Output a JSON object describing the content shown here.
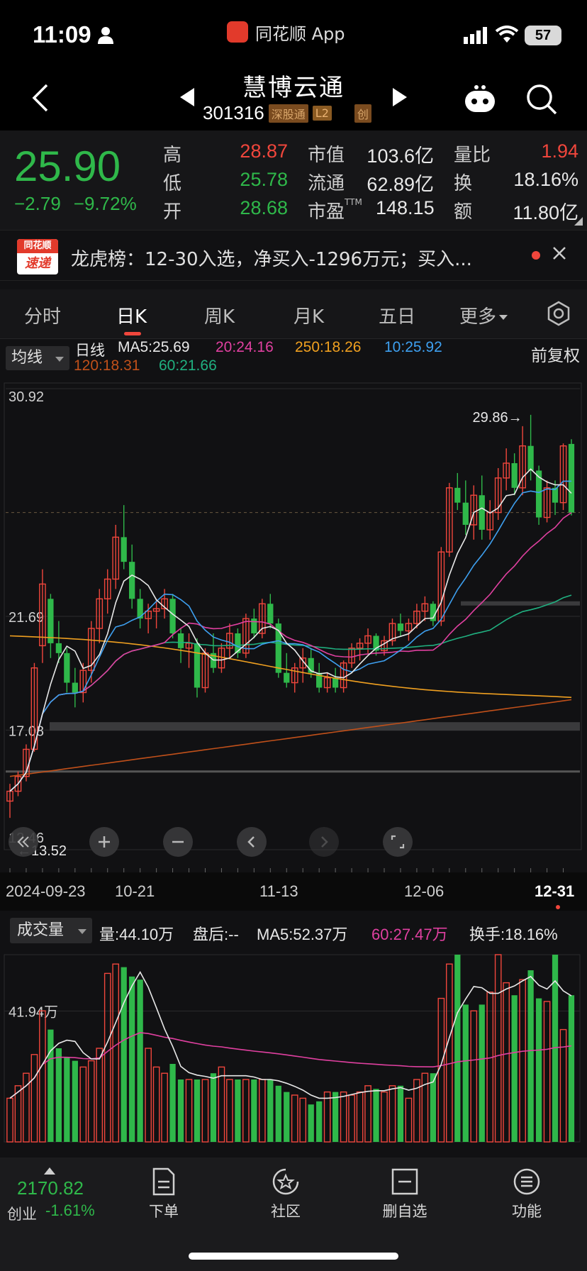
{
  "status_bar": {
    "time": "11:09",
    "app_label": "同花顺 App",
    "battery": "57"
  },
  "nav": {
    "stock_name": "慧博云通",
    "stock_code": "301316",
    "badges": [
      "深股通",
      "L2",
      "创"
    ]
  },
  "quote": {
    "price": "25.90",
    "change": "−2.79",
    "change_pct": "−9.72%",
    "high_label": "高",
    "high": "28.87",
    "low_label": "低",
    "low": "25.78",
    "open_label": "开",
    "open": "28.68",
    "mcap_label": "市值",
    "mcap": "103.6亿",
    "float_label": "流通",
    "float": "62.89亿",
    "pe_label": "市盈",
    "pe_sup": "TTM",
    "pe": "148.15",
    "vr_label": "量比",
    "vr": "1.94",
    "turnover_label": "换",
    "turnover": "18.16%",
    "amount_label": "额",
    "amount": "11.80亿"
  },
  "news": {
    "logo_top": "同花顺",
    "logo_bottom": "速递",
    "text": "龙虎榜：12-30入选，净买入-1296万元；买入..."
  },
  "tabs": [
    "分时",
    "日K",
    "周K",
    "月K",
    "五日",
    "更多"
  ],
  "ma_legend": {
    "select": "均线",
    "line_label": "日线",
    "right_label": "前复权",
    "items": [
      {
        "text": "MA5:25.69",
        "color": "#e8e8e8"
      },
      {
        "text": "20:24.16",
        "color": "#e040a0"
      },
      {
        "text": "250:18.26",
        "color": "#f0a020"
      },
      {
        "text": "10:25.92",
        "color": "#3ea0f0"
      },
      {
        "text": "120:18.31",
        "color": "#c0501a"
      },
      {
        "text": "60:21.66",
        "color": "#20b080"
      }
    ]
  },
  "price_axis": {
    "top": "30.92",
    "mid": "21.69",
    "low": "17.08",
    "bottom": "12.46",
    "max_mark": "29.86→",
    "min_mark": "←13.52"
  },
  "dates": [
    "2024-09-23",
    "10-21",
    "11-13",
    "12-06",
    "12-31"
  ],
  "vol_legend": {
    "select": "成交量",
    "vol": "量:44.10万",
    "after": "盘后:--",
    "ma5": "MA5:52.37万",
    "ma60": "60:27.47万",
    "turnover": "换手:18.16%",
    "axis_label": "41.94万"
  },
  "bottom_bar": {
    "index_value": "2170.82",
    "index_name": "创业",
    "index_change": "-1.61%",
    "buttons": [
      "下单",
      "社区",
      "删自选",
      "功能"
    ]
  },
  "chart_data": {
    "type": "candlestick",
    "x_range": [
      "2024-09-23",
      "2024-12-31"
    ],
    "y_range": [
      12.46,
      30.92
    ],
    "candles": [
      [
        14.2,
        14.9,
        13.52,
        14.6
      ],
      [
        14.6,
        15.4,
        14.4,
        15.2
      ],
      [
        15.2,
        16.5,
        15.0,
        16.3
      ],
      [
        16.3,
        19.8,
        16.2,
        19.6
      ],
      [
        20.5,
        23.6,
        19.8,
        23.0
      ],
      [
        22.4,
        22.6,
        20.0,
        20.6
      ],
      [
        20.6,
        21.5,
        19.8,
        20.2
      ],
      [
        20.2,
        20.4,
        18.6,
        19.0
      ],
      [
        19.0,
        19.6,
        18.0,
        18.6
      ],
      [
        18.6,
        19.8,
        18.2,
        19.5
      ],
      [
        19.5,
        21.5,
        19.0,
        21.2
      ],
      [
        21.2,
        22.8,
        20.6,
        22.4
      ],
      [
        22.4,
        23.6,
        21.8,
        23.2
      ],
      [
        23.2,
        25.4,
        22.8,
        24.9
      ],
      [
        24.9,
        26.2,
        23.6,
        23.9
      ],
      [
        23.9,
        24.6,
        22.0,
        22.4
      ],
      [
        22.4,
        22.8,
        21.2,
        21.6
      ],
      [
        21.6,
        22.2,
        21.0,
        21.9
      ],
      [
        21.9,
        22.4,
        21.2,
        22.0
      ],
      [
        22.0,
        22.8,
        21.6,
        22.4
      ],
      [
        22.4,
        22.6,
        20.8,
        21.0
      ],
      [
        21.0,
        21.2,
        19.8,
        20.4
      ],
      [
        20.4,
        21.0,
        19.6,
        20.6
      ],
      [
        20.6,
        20.8,
        18.4,
        18.8
      ],
      [
        18.8,
        20.4,
        18.6,
        20.2
      ],
      [
        20.2,
        21.0,
        19.4,
        19.6
      ],
      [
        19.6,
        20.6,
        19.4,
        20.4
      ],
      [
        20.4,
        21.4,
        20.0,
        21.0
      ],
      [
        21.0,
        21.2,
        20.0,
        20.2
      ],
      [
        20.2,
        21.8,
        20.0,
        21.6
      ],
      [
        21.6,
        22.0,
        20.8,
        21.0
      ],
      [
        21.0,
        22.4,
        20.8,
        22.2
      ],
      [
        22.2,
        22.6,
        21.2,
        21.4
      ],
      [
        21.4,
        21.6,
        19.2,
        19.4
      ],
      [
        19.4,
        20.2,
        18.8,
        19.0
      ],
      [
        19.0,
        19.8,
        18.6,
        19.6
      ],
      [
        19.6,
        20.4,
        19.0,
        20.0
      ],
      [
        20.0,
        20.4,
        19.2,
        19.4
      ],
      [
        19.4,
        19.8,
        18.6,
        18.8
      ],
      [
        18.8,
        19.4,
        18.6,
        19.2
      ],
      [
        19.2,
        19.6,
        18.6,
        18.8
      ],
      [
        18.8,
        19.9,
        18.6,
        19.8
      ],
      [
        19.8,
        20.6,
        19.6,
        20.4
      ],
      [
        20.4,
        20.8,
        19.9,
        20.6
      ],
      [
        20.6,
        21.2,
        20.2,
        20.9
      ],
      [
        20.9,
        21.0,
        20.1,
        20.3
      ],
      [
        20.3,
        20.9,
        20.1,
        20.7
      ],
      [
        20.7,
        21.6,
        20.5,
        21.4
      ],
      [
        21.4,
        21.8,
        20.9,
        21.1
      ],
      [
        21.1,
        21.6,
        20.7,
        21.4
      ],
      [
        21.4,
        22.2,
        21.2,
        21.9
      ],
      [
        21.9,
        22.5,
        21.5,
        22.2
      ],
      [
        22.2,
        22.3,
        21.3,
        21.5
      ],
      [
        21.5,
        24.5,
        21.3,
        24.3
      ],
      [
        24.3,
        27.1,
        24.1,
        26.9
      ],
      [
        26.9,
        27.5,
        26.0,
        26.3
      ],
      [
        26.3,
        27.2,
        25.0,
        25.4
      ],
      [
        25.4,
        27.0,
        24.8,
        26.6
      ],
      [
        26.6,
        27.4,
        24.8,
        25.2
      ],
      [
        25.2,
        26.4,
        24.8,
        25.9
      ],
      [
        25.9,
        27.7,
        25.6,
        27.3
      ],
      [
        27.3,
        28.5,
        26.8,
        27.9
      ],
      [
        27.9,
        28.3,
        26.6,
        26.9
      ],
      [
        26.9,
        29.4,
        26.6,
        28.6
      ],
      [
        28.6,
        29.86,
        27.2,
        27.6
      ],
      [
        27.6,
        27.8,
        25.4,
        25.7
      ],
      [
        25.7,
        27.2,
        25.5,
        26.9
      ],
      [
        26.9,
        27.2,
        25.8,
        26.3
      ],
      [
        26.3,
        28.7,
        26.0,
        28.6
      ],
      [
        28.68,
        28.87,
        25.78,
        25.9
      ]
    ],
    "volumes": [
      14,
      18,
      22,
      28,
      42,
      36,
      30,
      27,
      26,
      24,
      26,
      30,
      54,
      57,
      56,
      53,
      52,
      30,
      24,
      22,
      25,
      20,
      20,
      20,
      20,
      22,
      24,
      20,
      20,
      20,
      20,
      20,
      20,
      18,
      16,
      15,
      14,
      12,
      13,
      16,
      16,
      16,
      15,
      16,
      18,
      17,
      16,
      18,
      18,
      14,
      20,
      22,
      22,
      46,
      57,
      60,
      44,
      42,
      44,
      48,
      60,
      51,
      47,
      52,
      55,
      46,
      45,
      60,
      36,
      47
    ]
  }
}
